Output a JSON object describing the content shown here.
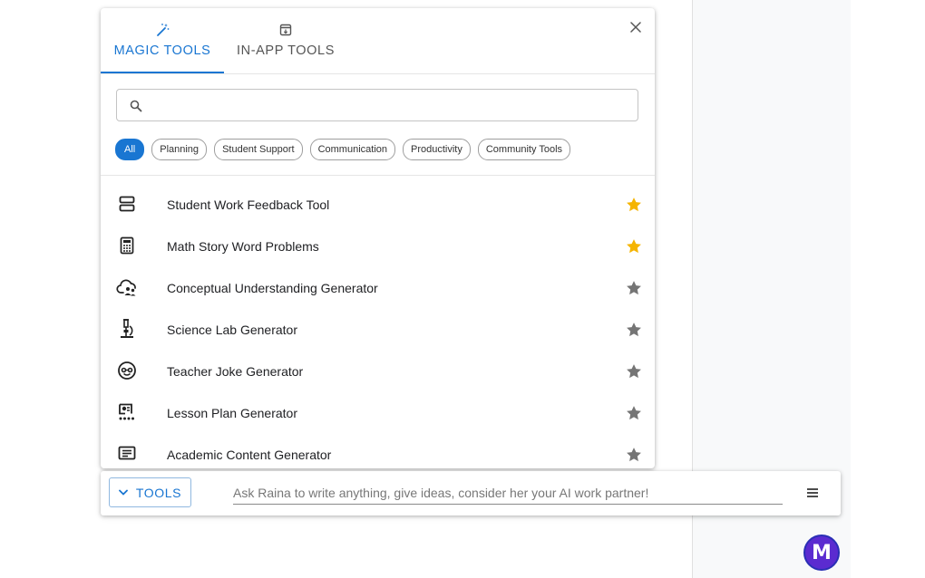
{
  "colors": {
    "accent": "#1976d2",
    "star_active": "#f5b400",
    "star_inactive": "#757575",
    "avatar": "#5b2bd0"
  },
  "tabs": [
    {
      "label": "MAGIC TOOLS",
      "icon": "magic-wand-icon",
      "active": true
    },
    {
      "label": "IN-APP TOOLS",
      "icon": "app-window-icon",
      "active": false
    }
  ],
  "search": {
    "placeholder": "",
    "value": ""
  },
  "filters": [
    "All",
    "Planning",
    "Student Support",
    "Communication",
    "Productivity",
    "Community Tools"
  ],
  "active_filter": "All",
  "tools": [
    {
      "label": "Student Work Feedback Tool",
      "icon": "feedback-stack-icon",
      "favorite": true
    },
    {
      "label": "Math Story Word Problems",
      "icon": "calculator-icon",
      "favorite": true
    },
    {
      "label": "Conceptual Understanding Generator",
      "icon": "cloud-people-icon",
      "favorite": false
    },
    {
      "label": "Science Lab Generator",
      "icon": "microscope-icon",
      "favorite": false
    },
    {
      "label": "Teacher Joke Generator",
      "icon": "laugh-face-icon",
      "favorite": false
    },
    {
      "label": "Lesson Plan Generator",
      "icon": "lesson-board-icon",
      "favorite": false
    },
    {
      "label": "Academic Content Generator",
      "icon": "document-icon",
      "favorite": false
    }
  ],
  "bottom_bar": {
    "tools_label": "TOOLS",
    "ask_placeholder": "Ask Raina to write anything, give ideas, consider her your AI work partner!"
  },
  "avatar_letter": "M"
}
